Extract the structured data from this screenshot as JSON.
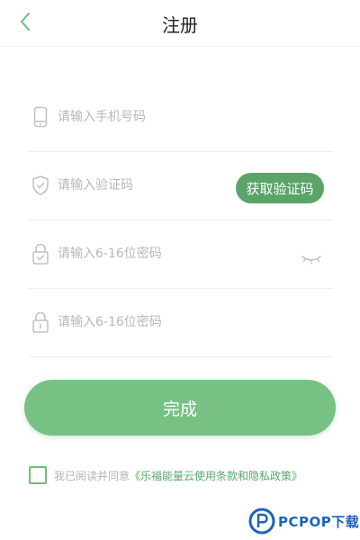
{
  "header": {
    "title": "注册",
    "back_icon": "chevron-left-icon"
  },
  "form": {
    "phone": {
      "placeholder": "请输入手机号码",
      "icon": "phone-icon"
    },
    "code": {
      "placeholder": "请输入验证码",
      "icon": "shield-icon",
      "button_label": "获取验证码"
    },
    "password": {
      "placeholder": "请输入6-16位密码",
      "icon": "lock-icon",
      "toggle_icon": "eye-closed-icon"
    },
    "confirm_password": {
      "placeholder": "请输入6-16位密码",
      "icon": "lock-icon"
    },
    "submit_label": "完成"
  },
  "agreement": {
    "text": "我已阅读并同意",
    "link": "《乐福能量云使用条款和隐私政策》",
    "checked": false
  },
  "watermark": {
    "text": "PCPOP下载"
  },
  "colors": {
    "accent": "#5aa46a",
    "button": "#77c185",
    "placeholder": "#b8b8b8",
    "checkbox_border": "#6abf79",
    "link": "#58a86a",
    "watermark": "#1f63b7"
  }
}
